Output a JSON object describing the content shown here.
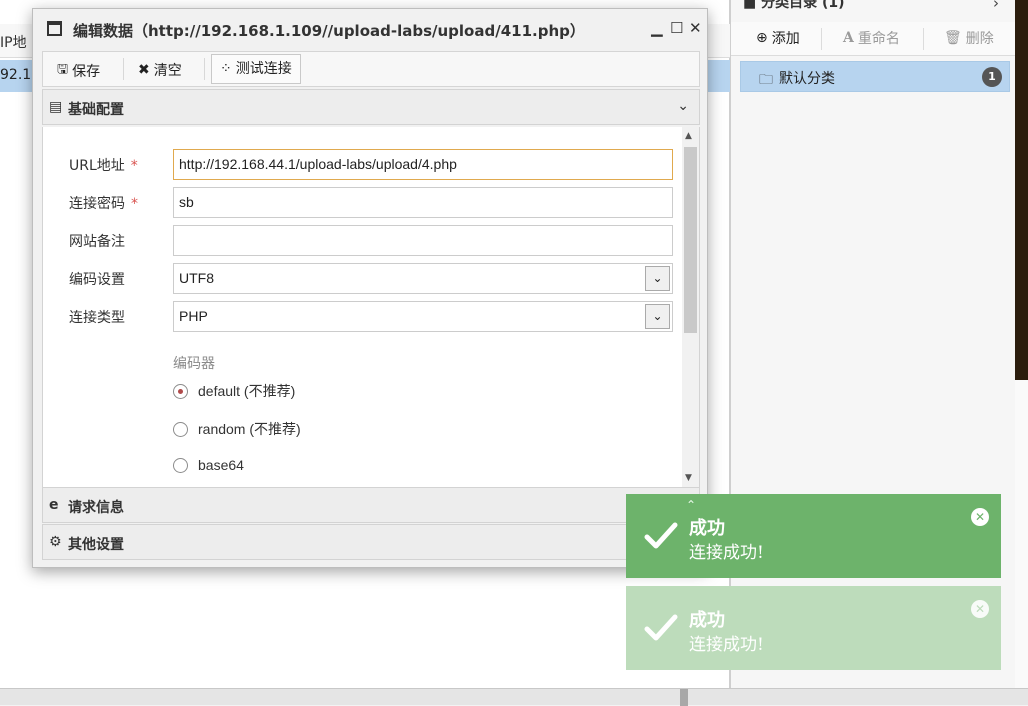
{
  "background": {
    "list_header": "IP地",
    "selected_row": "92.1"
  },
  "right_pane": {
    "title": "分类目录 (1)",
    "toolbar": {
      "add": "添加",
      "rename": "重命名",
      "delete": "删除"
    },
    "category": {
      "label": "默认分类",
      "count": "1"
    }
  },
  "dialog": {
    "title": "编辑数据（http://192.168.1.109//upload-labs/upload/411.php）",
    "controls": {
      "minimize": "▁",
      "maximize": "☐",
      "close": "✕"
    },
    "toolbar": {
      "save": "保存",
      "clear": "清空",
      "test": "测试连接"
    },
    "section_basic": "基础配置",
    "form": {
      "url_label": "URL地址",
      "url_value": "http://192.168.44.1/upload-labs/upload/4.php",
      "password_label": "连接密码",
      "password_value": "sb",
      "note_label": "网站备注",
      "note_value": "",
      "encoding_label": "编码设置",
      "encoding_value": "UTF8",
      "type_label": "连接类型",
      "type_value": "PHP",
      "encoder_title": "编码器",
      "encoders": [
        {
          "label": "default (不推荐)",
          "checked": true
        },
        {
          "label": "random (不推荐)",
          "checked": false
        },
        {
          "label": "base64",
          "checked": false
        }
      ],
      "required_mark": "*"
    },
    "section_request": "请求信息",
    "section_other": "其他设置"
  },
  "toasts": [
    {
      "title": "成功",
      "message": "连接成功!"
    },
    {
      "title": "成功",
      "message": "连接成功!"
    }
  ],
  "colors": {
    "toast_success": "#6db36b",
    "selection": "#b7d4ef",
    "required": "#d9534f",
    "focus_border": "#e0a94e"
  }
}
